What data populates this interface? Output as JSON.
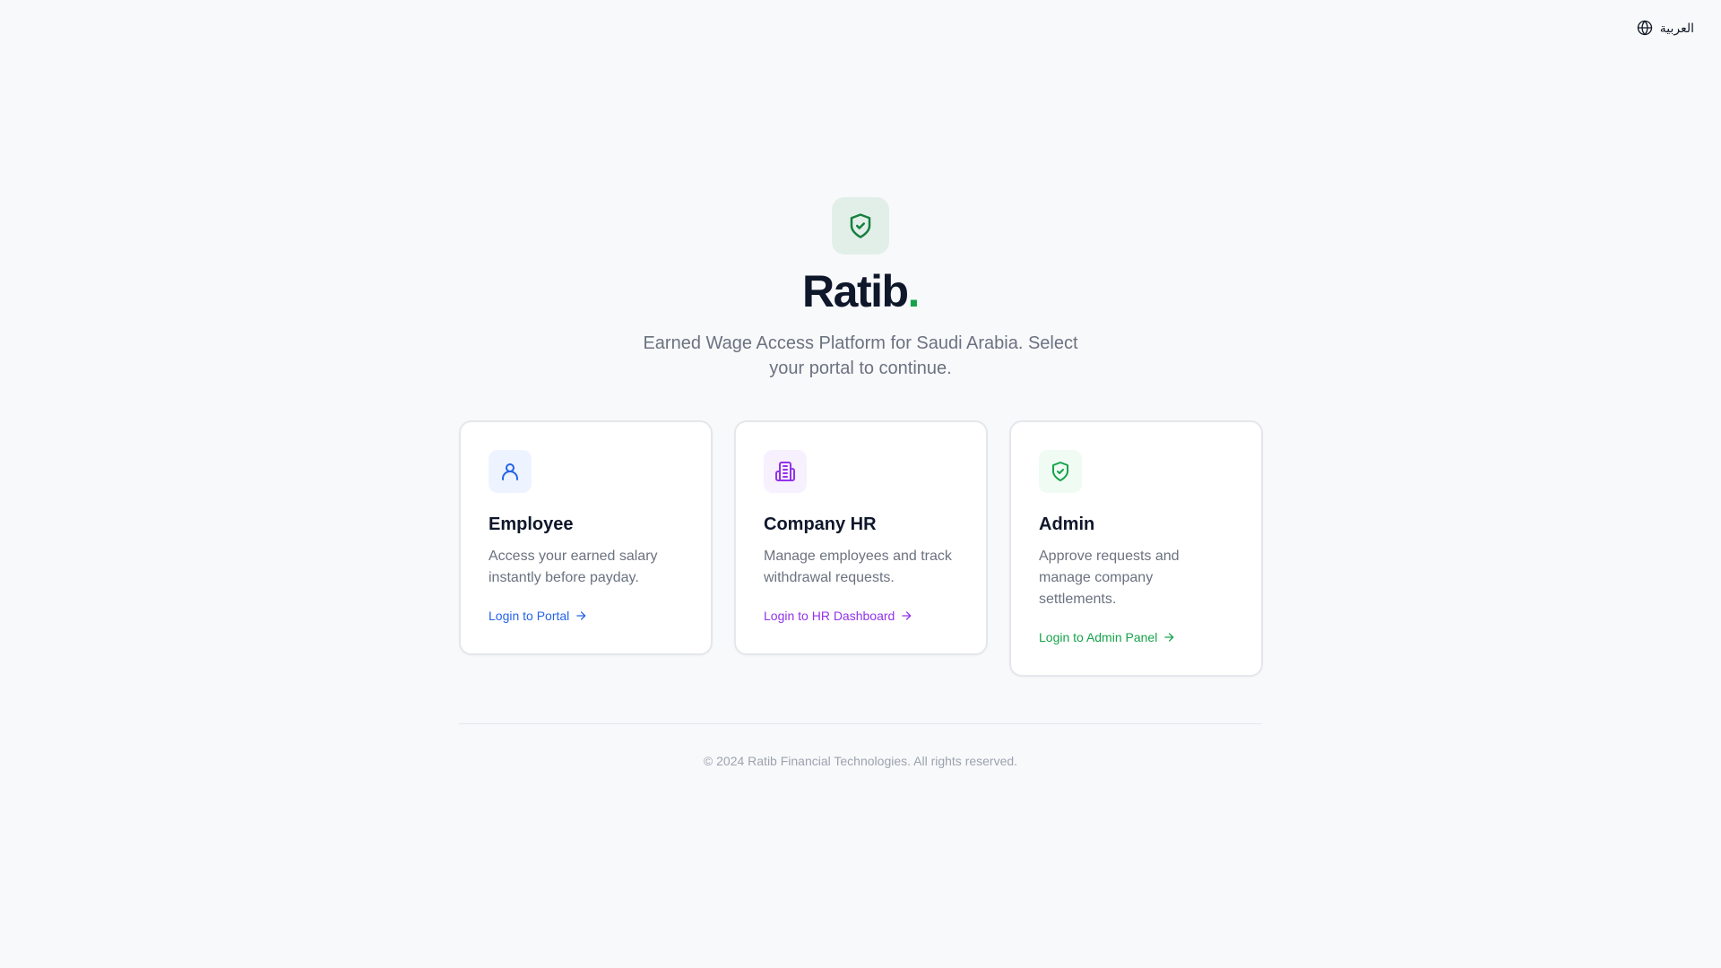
{
  "language_switch": {
    "label": "العربية",
    "icon": "globe-icon"
  },
  "hero": {
    "logo_icon": "shield-check-icon",
    "brand_name": "Ratib",
    "brand_dot": ".",
    "tagline": "Earned Wage Access Platform for Saudi Arabia. Select your portal to continue."
  },
  "cards": [
    {
      "title": "Employee",
      "description": "Access your earned salary instantly before payday.",
      "link": "Login to Portal",
      "icon": "user-icon",
      "accent": "#2563eb",
      "icon_bg": "#eef4ff"
    },
    {
      "title": "Company HR",
      "description": "Manage employees and track withdrawal requests.",
      "link": "Login to HR Dashboard",
      "icon": "building-icon",
      "accent": "#9333ea",
      "icon_bg": "#f7f0fe"
    },
    {
      "title": "Admin",
      "description": "Approve requests and manage company settlements.",
      "link": "Login to Admin Panel",
      "icon": "shield-check-icon",
      "accent": "#16a34a",
      "icon_bg": "#effbf3"
    }
  ],
  "footer": {
    "copyright": "© 2024 Ratib Financial Technologies. All rights reserved."
  },
  "colors": {
    "brand_green": "#16a34a",
    "logo_bg": "#e2efe9",
    "background": "#f8f9fb"
  }
}
